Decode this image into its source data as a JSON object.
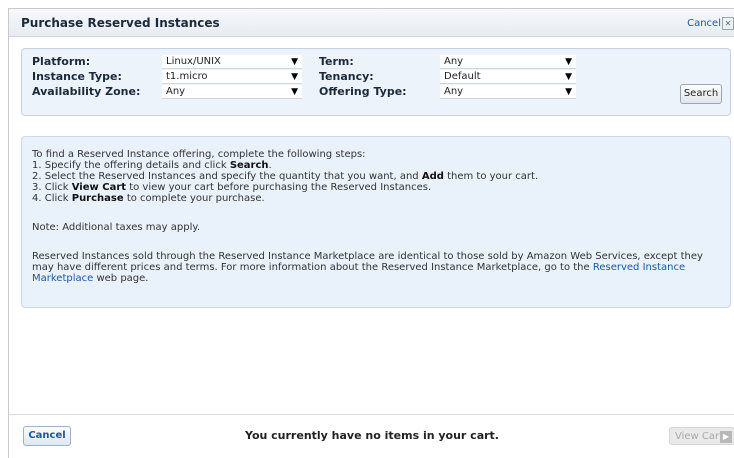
{
  "dialog": {
    "title": "Purchase Reserved Instances",
    "cancel_link": "Cancel"
  },
  "search": {
    "platform_label": "Platform:",
    "platform_value": "Linux/UNIX",
    "instance_type_label": "Instance Type:",
    "instance_type_value": "t1.micro",
    "availability_zone_label": "Availability Zone:",
    "availability_zone_value": "Any",
    "term_label": "Term:",
    "term_value": "Any",
    "tenancy_label": "Tenancy:",
    "tenancy_value": "Default",
    "offering_type_label": "Offering Type:",
    "offering_type_value": "Any",
    "search_button": "Search"
  },
  "info": {
    "intro": "To find a Reserved Instance offering, complete the following steps:",
    "step1_a": "1.  Specify the offering details and click ",
    "step1_b": "Search",
    "step1_c": ".",
    "step2_a": "2.  Select the Reserved Instances and specify the quantity that you want, and ",
    "step2_b": "Add",
    "step2_c": " them to your cart.",
    "step3_a": "3.  Click ",
    "step3_b": "View Cart",
    "step3_c": " to view your cart before purchasing the Reserved Instances.",
    "step4_a": "4.  Click ",
    "step4_b": "Purchase",
    "step4_c": " to complete your purchase.",
    "note": "Note: Additional taxes may apply.",
    "marketplace_a": "Reserved Instances sold through the Reserved Instance Marketplace are identical to those sold by Amazon Web Services, except they may have different prices and terms. For more information about the Reserved Instance Marketplace, go to the ",
    "marketplace_link": "Reserved Instance Marketplace",
    "marketplace_c": " web page."
  },
  "footer": {
    "cancel_button": "Cancel",
    "cart_message": "You currently have no items in your cart.",
    "view_cart_button": "View Cart"
  },
  "colors": {
    "panel_bg": "#edf3fa",
    "link": "#1b57a5"
  }
}
